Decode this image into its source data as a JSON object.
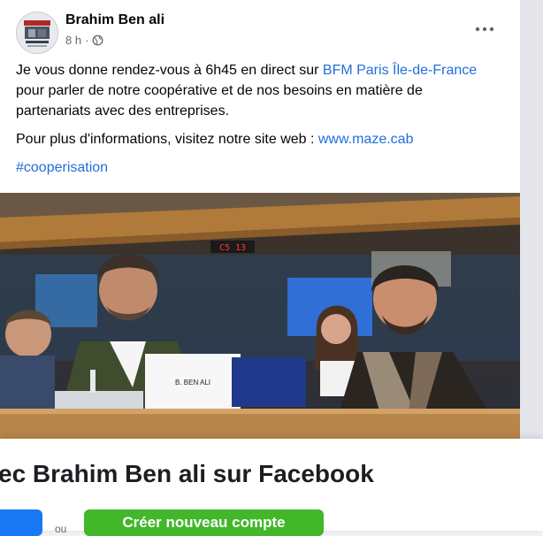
{
  "post": {
    "author": "Brahim Ben ali",
    "time": "8 h",
    "separator": "·",
    "text_intro": "Je vous donne rendez-vous à 6h45 en direct sur ",
    "link_channel": "BFM Paris Île-de-France",
    "text_after_link": " pour parler de notre coopérative et de nos besoins en matière de partenariats avec des entreprises.",
    "text_info": "Pour plus d'informations, visitez notre site web : ",
    "link_site": "www.maze.cab",
    "hashtag": "#cooperisation",
    "photo_nameplate": "B. BEN ALI",
    "photo_screen_code": "C5  13"
  },
  "banner": {
    "title": "ec Brahim Ben ali sur Facebook",
    "or_label": "ou",
    "signup_label": "Créer nouveau compte"
  },
  "icons": {
    "more": "more-horizontal-icon",
    "privacy": "globe-icon"
  },
  "colors": {
    "link": "#216fdb",
    "login": "#1877f2",
    "signup": "#42b72a"
  }
}
